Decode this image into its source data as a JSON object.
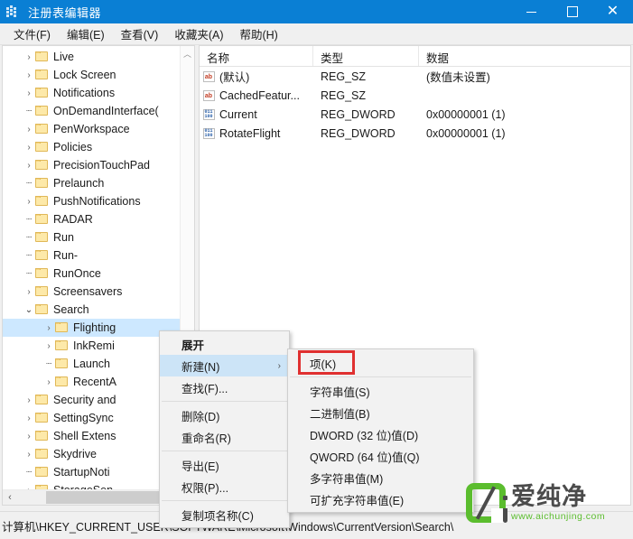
{
  "window": {
    "title": "注册表编辑器",
    "icon": "registry-icon",
    "controls": {
      "minimize": "—",
      "maximize": "□",
      "close": "✕"
    }
  },
  "menubar": {
    "items": [
      {
        "label": "文件(F)"
      },
      {
        "label": "编辑(E)"
      },
      {
        "label": "查看(V)"
      },
      {
        "label": "收藏夹(A)"
      },
      {
        "label": "帮助(H)"
      }
    ]
  },
  "tree": {
    "nodes": [
      {
        "label": "Live",
        "indent": 1,
        "expander": "collapsed"
      },
      {
        "label": "Lock Screen",
        "indent": 1,
        "expander": "collapsed"
      },
      {
        "label": "Notifications",
        "indent": 1,
        "expander": "collapsed"
      },
      {
        "label": "OnDemandInterface(",
        "indent": 1,
        "expander": "none"
      },
      {
        "label": "PenWorkspace",
        "indent": 1,
        "expander": "collapsed"
      },
      {
        "label": "Policies",
        "indent": 1,
        "expander": "collapsed"
      },
      {
        "label": "PrecisionTouchPad",
        "indent": 1,
        "expander": "collapsed"
      },
      {
        "label": "Prelaunch",
        "indent": 1,
        "expander": "none"
      },
      {
        "label": "PushNotifications",
        "indent": 1,
        "expander": "collapsed"
      },
      {
        "label": "RADAR",
        "indent": 1,
        "expander": "none"
      },
      {
        "label": "Run",
        "indent": 1,
        "expander": "none"
      },
      {
        "label": "Run-",
        "indent": 1,
        "expander": "none"
      },
      {
        "label": "RunOnce",
        "indent": 1,
        "expander": "none"
      },
      {
        "label": "Screensavers",
        "indent": 1,
        "expander": "collapsed"
      },
      {
        "label": "Search",
        "indent": 1,
        "expander": "expanded"
      },
      {
        "label": "Flighting",
        "indent": 2,
        "expander": "collapsed",
        "selected": true
      },
      {
        "label": "InkRemi",
        "indent": 2,
        "expander": "collapsed"
      },
      {
        "label": "Launch",
        "indent": 2,
        "expander": "none"
      },
      {
        "label": "RecentA",
        "indent": 2,
        "expander": "collapsed"
      },
      {
        "label": "Security and",
        "indent": 1,
        "expander": "collapsed"
      },
      {
        "label": "SettingSync",
        "indent": 1,
        "expander": "collapsed"
      },
      {
        "label": "Shell Extens",
        "indent": 1,
        "expander": "collapsed"
      },
      {
        "label": "Skydrive",
        "indent": 1,
        "expander": "collapsed"
      },
      {
        "label": "StartupNoti",
        "indent": 1,
        "expander": "none"
      },
      {
        "label": "StorageSen",
        "indent": 1,
        "expander": "collapsed"
      }
    ],
    "scroll_up_arrow": "︿",
    "hscroll_left_arrow": "‹"
  },
  "list": {
    "columns": [
      "名称",
      "类型",
      "数据"
    ],
    "rows": [
      {
        "icon": "string-value-icon",
        "name": "(默认)",
        "type": "REG_SZ",
        "data": "(数值未设置)"
      },
      {
        "icon": "string-value-icon",
        "name": "CachedFeatur...",
        "type": "REG_SZ",
        "data": ""
      },
      {
        "icon": "binary-value-icon",
        "name": "Current",
        "type": "REG_DWORD",
        "data": "0x00000001 (1)"
      },
      {
        "icon": "binary-value-icon",
        "name": "RotateFlight",
        "type": "REG_DWORD",
        "data": "0x00000001 (1)"
      }
    ]
  },
  "context_menu": {
    "items": [
      {
        "label": "展开",
        "bold": true,
        "highlighted": false,
        "submenu": false
      },
      {
        "label": "新建(N)",
        "bold": false,
        "highlighted": true,
        "submenu": true,
        "chevron": "›"
      },
      {
        "label": "查找(F)...",
        "bold": false,
        "highlighted": false,
        "submenu": false
      },
      {
        "separator": true
      },
      {
        "label": "删除(D)",
        "bold": false,
        "highlighted": false,
        "submenu": false
      },
      {
        "label": "重命名(R)",
        "bold": false,
        "highlighted": false,
        "submenu": false
      },
      {
        "separator": true
      },
      {
        "label": "导出(E)",
        "bold": false,
        "highlighted": false,
        "submenu": false
      },
      {
        "label": "权限(P)...",
        "bold": false,
        "highlighted": false,
        "submenu": false
      },
      {
        "separator": true
      },
      {
        "label": "复制项名称(C)",
        "bold": false,
        "highlighted": false,
        "submenu": false
      }
    ]
  },
  "submenu": {
    "items": [
      {
        "label": "项(K)",
        "annotated": true
      },
      {
        "separator": true
      },
      {
        "label": "字符串值(S)"
      },
      {
        "label": "二进制值(B)"
      },
      {
        "label": "DWORD (32 位)值(D)"
      },
      {
        "label": "QWORD (64 位)值(Q)"
      },
      {
        "label": "多字符串值(M)"
      },
      {
        "label": "可扩充字符串值(E)"
      }
    ],
    "annotation_color": "#e03030"
  },
  "statusbar": {
    "path": "计算机\\HKEY_CURRENT_USER\\SOFTWARE\\Microsoft\\Windows\\CurrentVersion\\Search\\"
  },
  "watermark": {
    "brand": "爱纯净",
    "url": "www.aichunjing.com",
    "color": "#5bbd2e"
  },
  "colors": {
    "titlebar": "#0a7fd4",
    "selection": "#cde8ff",
    "menu_highlight": "#cce4f7",
    "folder": "#fde9a9"
  }
}
